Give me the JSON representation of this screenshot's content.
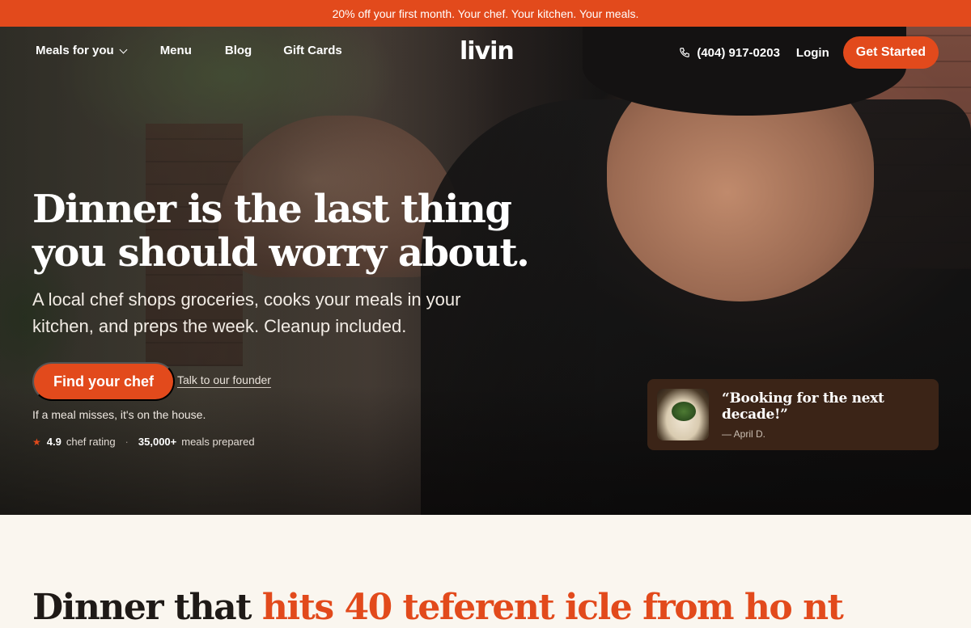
{
  "promo": {
    "text": "20% off your first month. Your chef. Your kitchen. Your meals."
  },
  "nav": {
    "logo": "livin",
    "meals_for_you": "Meals for you",
    "menu": "Menu",
    "blog": "Blog",
    "gift_cards": "Gift Cards",
    "phone": "(404) 917-0203",
    "login": "Login",
    "get_started": "Get Started"
  },
  "hero": {
    "headline": "Dinner is the last thing you should worry about.",
    "subhead": "A local chef shops groceries, cooks your meals in your kitchen, and preps the week. Cleanup included.",
    "cta_primary": "Find your chef",
    "cta_secondary": "Talk to our founder",
    "guarantee": "If a meal misses, it's on the house.",
    "rating_value": "4.9",
    "rating_label": "chef rating",
    "meals_value": "35,000+",
    "meals_label": "meals prepared"
  },
  "testimonial": {
    "quote": "“Booking for the next decade!”",
    "author": "— April D."
  },
  "section": {
    "title_start": "Dinner that",
    "title_accent": "hits 40 teferent icle from ho nt"
  },
  "colors": {
    "accent": "#e24a1c",
    "testimonial_bg": "#3b2417",
    "page_bg": "#faf6ef"
  }
}
